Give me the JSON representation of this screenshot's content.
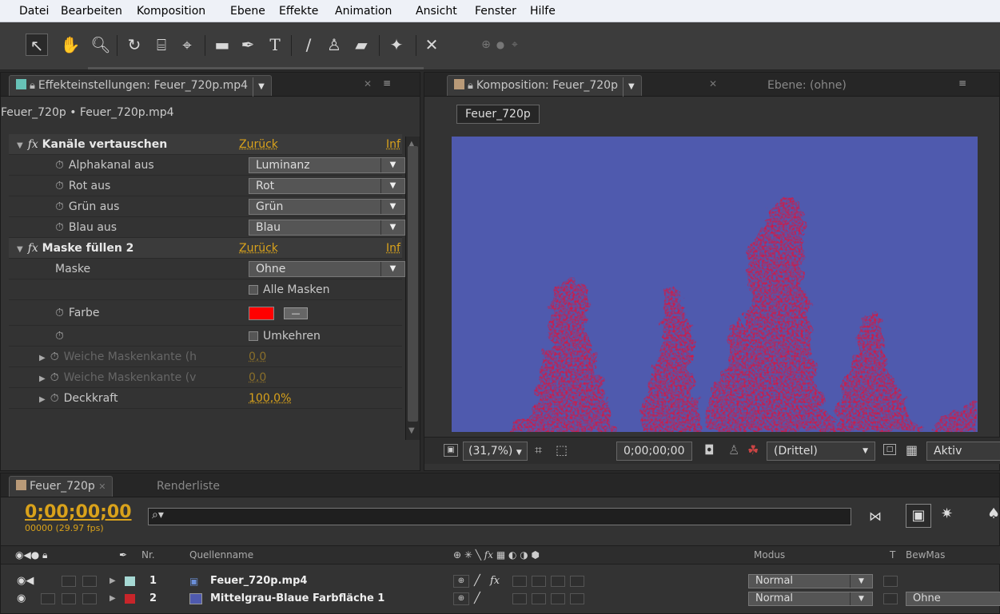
{
  "menu": [
    "Datei",
    "Bearbeiten",
    "Komposition",
    "Ebene",
    "Effekte",
    "Animation",
    "Ansicht",
    "Fenster",
    "Hilfe"
  ],
  "toolbar": {
    "tools": [
      "selection-tool",
      "hand-tool",
      "zoom-tool",
      "rotation-tool",
      "camera-tool",
      "pan-behind-tool",
      "rectangle-tool",
      "pen-tool",
      "text-tool",
      "brush-tool",
      "clone-stamp-tool",
      "eraser-tool",
      "roto-brush-tool",
      "puppet-pin-tool"
    ]
  },
  "effect_panel": {
    "tab_title": "Effekteinstellungen: Feuer_720p.mp4",
    "swatch_color": "#67c2b7",
    "breadcrumb": "Feuer_720p • Feuer_720p.mp4",
    "effect1": {
      "name": "Kanäle vertauschen",
      "reset": "Zurück",
      "info": "Inf",
      "rows": [
        {
          "label": "Alphakanal aus",
          "value": "Luminanz"
        },
        {
          "label": "Rot aus",
          "value": "Rot"
        },
        {
          "label": "Grün aus",
          "value": "Grün"
        },
        {
          "label": "Blau aus",
          "value": "Blau"
        }
      ]
    },
    "effect2": {
      "name": "Maske füllen 2",
      "reset": "Zurück",
      "info": "Inf",
      "mask_label": "Maske",
      "mask_value": "Ohne",
      "all_masks": "Alle Masken",
      "color_label": "Farbe",
      "fill_color": "#ff0000",
      "invert": "Umkehren",
      "feather_h_label": "Weiche Maskenkante (h",
      "feather_h_value": "0,0",
      "feather_v_label": "Weiche Maskenkante (v",
      "feather_v_value": "0,0",
      "opacity_label": "Deckkraft",
      "opacity_value": "100,0%"
    }
  },
  "comp_panel": {
    "tab_title": "Komposition: Feuer_720p",
    "layer_tab": "Ebene: (ohne)",
    "comp_button": "Feuer_720p",
    "bg_color": "#4f5aae",
    "fire_color": "#d8123f",
    "zoom": "(31,7%)",
    "timecode": "0;00;00;00",
    "grid": "(Drittel)",
    "active": "Aktiv"
  },
  "timeline": {
    "tab_comp": "Feuer_720p",
    "tab_render": "Renderliste",
    "timecode": "0;00;00;00",
    "frames": "00000 (29.97 fps)",
    "columns": {
      "nr": "Nr.",
      "source": "Quellenname",
      "mode": "Modus",
      "t": "T",
      "trkmat": "BewMas"
    },
    "layers": [
      {
        "nr": "1",
        "name": "Feuer_720p.mp4",
        "color": "#a6d9d4",
        "mode": "Normal",
        "trkmat": ""
      },
      {
        "nr": "2",
        "name": "Mittelgrau-Blaue Farbfläche 1",
        "color": "#c8252a",
        "icon_color": "#4f5aae",
        "mode": "Normal",
        "trkmat": "Ohne"
      }
    ]
  }
}
